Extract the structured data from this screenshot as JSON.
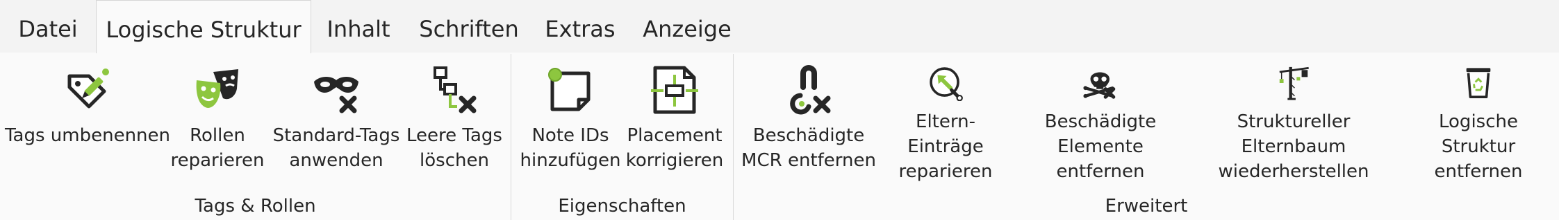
{
  "tabs": [
    "Datei",
    "Logische Struktur",
    "Inhalt",
    "Schriften",
    "Extras",
    "Anzeige"
  ],
  "active_tab": "Logische Struktur",
  "colors": {
    "accent_green": "#8dc63f",
    "icon_dark": "#262626"
  },
  "groups": [
    {
      "label": "Tags & Rollen",
      "buttons": [
        {
          "label": "Tags umbenennen",
          "icon": "tag-pencil-icon"
        },
        {
          "label": "Rollen\nreparieren",
          "icon": "theater-masks-icon"
        },
        {
          "label": "Standard-Tags\nanwenden",
          "icon": "mask-x-icon"
        },
        {
          "label": "Leere Tags\nlöschen",
          "icon": "tree-nodes-x-icon"
        }
      ]
    },
    {
      "label": "Eigenschaften",
      "buttons": [
        {
          "label": "Note IDs\nhinzufügen",
          "icon": "note-pin-icon"
        },
        {
          "label": "Placement\nkorrigieren",
          "icon": "placement-frame-icon"
        }
      ]
    },
    {
      "label": "Erweitert",
      "buttons": [
        {
          "label": "Beschädigte\nMCR entfernen",
          "icon": "broken-link-x-icon"
        },
        {
          "label": "Eltern-Einträge\nreparieren",
          "icon": "arrow-wrench-icon"
        },
        {
          "label": "Beschädigte\nElemente entfernen",
          "icon": "skull-x-icon"
        },
        {
          "label": "Struktureller Elternbaum\nwiederherstellen",
          "icon": "crane-icon"
        },
        {
          "label": "Logische Struktur\nentfernen",
          "icon": "recycle-bin-icon"
        }
      ]
    }
  ]
}
